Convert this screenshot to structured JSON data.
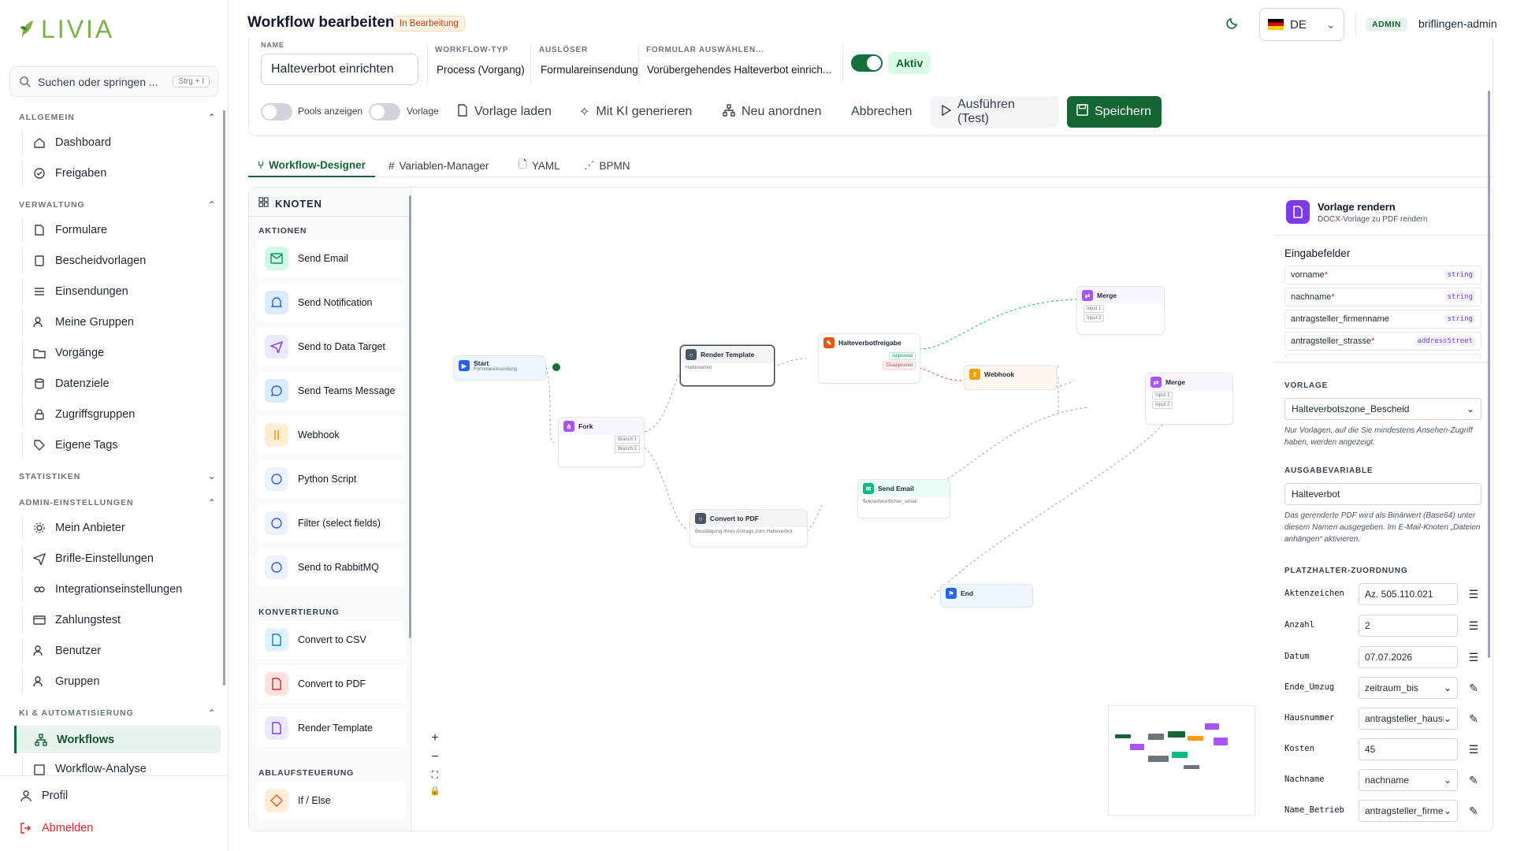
{
  "app": {
    "name": "LIVIA"
  },
  "search": {
    "placeholder": "Suchen oder springen ...",
    "shortcut": "Strg + I"
  },
  "sidebar": {
    "sections": [
      {
        "title": "ALLGEMEIN",
        "items": [
          "Dashboard",
          "Freigaben"
        ]
      },
      {
        "title": "VERWALTUNG",
        "items": [
          "Formulare",
          "Bescheidvorlagen",
          "Einsendungen",
          "Meine Gruppen",
          "Vorgänge",
          "Datenziele",
          "Zugriffsgruppen",
          "Eigene Tags"
        ]
      },
      {
        "title": "STATISTIKEN",
        "items": []
      },
      {
        "title": "ADMIN-EINSTELLUNGEN",
        "items": [
          "Mein Anbieter",
          "Brifle-Einstellungen",
          "Integrationseinstellungen",
          "Zahlungstest",
          "Benutzer",
          "Gruppen"
        ]
      },
      {
        "title": "KI & AUTOMATISIERUNG",
        "items": [
          "Workflows",
          "Workflow-Analyse"
        ]
      }
    ],
    "profile": "Profil",
    "logout": "Abmelden"
  },
  "header": {
    "title": "Workflow bearbeiten",
    "status": "In Bearbeitung",
    "lang": "DE",
    "role": "ADMIN",
    "user": "briflingen-admin"
  },
  "form": {
    "name_label": "NAME",
    "name_value": "Halteverbot einrichten",
    "type_label": "WORKFLOW-TYP",
    "type_value": "Process (Vorgang)",
    "trigger_label": "AUSLÖSER",
    "trigger_value": "Formulareinsendung",
    "form_label": "FORMULAR AUSWÄHLEN...",
    "form_value": "Vorübergehendes Halteverbot einrich...",
    "active_label": "Aktiv"
  },
  "toolbar": {
    "pools": "Pools anzeigen",
    "template": "Vorlage",
    "load": "Vorlage laden",
    "ai": "Mit KI generieren",
    "arrange": "Neu anordnen",
    "cancel": "Abbrechen",
    "run": "Ausführen (Test)",
    "save": "Speichern"
  },
  "tabs": [
    "Workflow-Designer",
    "Variablen-Manager",
    "YAML",
    "BPMN"
  ],
  "nodes_panel": {
    "title": "KNOTEN",
    "categories": [
      {
        "name": "AKTIONEN",
        "items": [
          "Send Email",
          "Send Notification",
          "Send to Data Target",
          "Send Teams Message",
          "Webhook",
          "Python Script",
          "Filter (select fields)",
          "Send to RabbitMQ"
        ]
      },
      {
        "name": "KONVERTIERUNG",
        "items": [
          "Convert to CSV",
          "Convert to PDF",
          "Render Template"
        ]
      },
      {
        "name": "ABLAUFSTEUERUNG",
        "items": [
          "If / Else"
        ]
      }
    ]
  },
  "canvas": {
    "nodes": {
      "start": {
        "title": "Start",
        "sub": "Formulareinsendung"
      },
      "fork": {
        "title": "Fork",
        "ports": [
          "Branch 1",
          "Branch 2"
        ]
      },
      "render": {
        "title": "Render Template",
        "sub": "Halteverbot"
      },
      "approval": {
        "title": "Halteverbotfreigabe",
        "ports": [
          "Approved",
          "Disapproved"
        ]
      },
      "webhook": {
        "title": "Webhook"
      },
      "merge1": {
        "title": "Merge",
        "ports": [
          "Input 1",
          "Input 2"
        ]
      },
      "merge2": {
        "title": "Merge",
        "ports": [
          "Input 1",
          "Input 2"
        ]
      },
      "convert": {
        "title": "Convert to PDF",
        "sub": "Bestätigung Ihres Antrags zum Halteverbot"
      },
      "email": {
        "title": "Send Email",
        "sub": "$verantwortlicher_email"
      },
      "end": {
        "title": "End"
      }
    },
    "zoom_controls": [
      "+",
      "−",
      "⛶",
      "🔒"
    ]
  },
  "details": {
    "title": "Vorlage rendern",
    "subtitle": "DOCX-Vorlage zu PDF rendern",
    "inputs_title": "Eingabefelder",
    "inputs": [
      {
        "name": "vorname",
        "required": true,
        "type": "string"
      },
      {
        "name": "nachname",
        "required": true,
        "type": "string"
      },
      {
        "name": "antragsteller_firmenname",
        "required": false,
        "type": "string"
      },
      {
        "name": "antragsteller_strasse",
        "required": true,
        "type": "addressStreet"
      }
    ],
    "template_label": "VORLAGE",
    "template_value": "Halteverbotszone_Bescheid",
    "template_note": "Nur Vorlagen, auf die Sie mindestens Ansehen-Zugriff haben, werden angezeigt.",
    "output_label": "AUSGABEVARIABLE",
    "output_value": "Halteverbot",
    "output_note": "Das gerenderte PDF wird als Binärwert (Base64) unter diesem Namen ausgegeben. Im E-Mail-Knoten „Dateien anhängen“ aktivieren.",
    "mapping_label": "PLATZHALTER-ZUORDNUNG",
    "mapping": [
      {
        "key": "Aktenzeichen",
        "value": "Az. 505.110.021",
        "mode": "list"
      },
      {
        "key": "Anzahl",
        "value": "2",
        "mode": "list"
      },
      {
        "key": "Datum",
        "value": "07.07.2026",
        "mode": "list"
      },
      {
        "key": "Ende_Umzug",
        "value": "zeitraum_bis",
        "mode": "select"
      },
      {
        "key": "Hausnummer",
        "value": "antragsteller_hausn",
        "mode": "select"
      },
      {
        "key": "Kosten",
        "value": "45",
        "mode": "list"
      },
      {
        "key": "Nachname",
        "value": "nachname",
        "mode": "select"
      },
      {
        "key": "Name_Betrieb",
        "value": "antragsteller_firme",
        "mode": "select"
      }
    ]
  },
  "colors": {
    "primary": "#166534",
    "accent_bg": "#e8f5ee",
    "purple": "#7c3aed",
    "orange": "#f59e0b",
    "green": "#10b981"
  }
}
